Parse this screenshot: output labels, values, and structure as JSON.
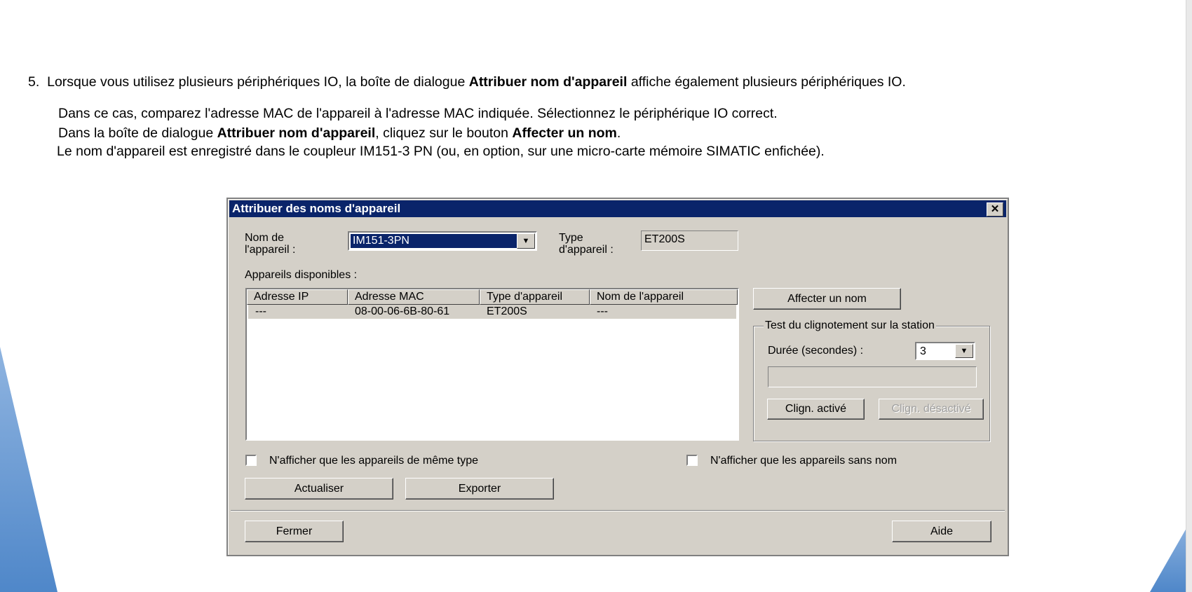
{
  "instructions": {
    "line1": {
      "num": "5.",
      "a": "Lorsque vous utilisez plusieurs périphériques IO, la boîte de dialogue ",
      "b": "Attribuer nom  d'appareil",
      "c": " affiche également plusieurs périphériques IO."
    },
    "line2": "Dans ce cas, comparez  l'adresse MAC de l'appareil à l'adresse MAC indiquée. Sélectionnez le périphérique IO  correct.",
    "line3": {
      "a": "Dans la boîte de dialogue ",
      "b": "Attribuer nom d'appareil",
      "c": ", cliquez sur le bouton ",
      "d": "Affecter  un nom",
      "e": "."
    },
    "line4": "Le nom d'appareil est enregistré dans le coupleur IM151-3 PN (ou, en option,  sur une micro-carte mémoire SIMATIC enfichée)."
  },
  "dialog": {
    "title": "Attribuer des noms d'appareil",
    "close_glyph": "✕",
    "device_name_label_1": "Nom de",
    "device_name_label_2": "l'appareil :",
    "device_name_value": "IM151-3PN",
    "device_type_label_1": "Type",
    "device_type_label_2": "d'appareil :",
    "device_type_value": "ET200S",
    "available_label": "Appareils disponibles :",
    "table": {
      "headers": [
        "Adresse IP",
        "Adresse MAC",
        "Type d'appareil",
        "Nom de l'appareil"
      ],
      "rows": [
        [
          "---",
          "08-00-06-6B-80-61",
          "ET200S",
          "---"
        ]
      ]
    },
    "assign_button": "Affecter un nom",
    "blink_group": {
      "title": "Test du clignotement sur la station",
      "duration_label": "Durée (secondes) :",
      "duration_value": "3",
      "blink_on": "Clign. activé",
      "blink_off": "Clign. désactivé"
    },
    "checkbox_same_type": "N'afficher que les appareils de même type",
    "checkbox_no_name": "N'afficher que les appareils sans nom",
    "refresh_button": "Actualiser",
    "export_button": "Exporter",
    "close_button": "Fermer",
    "help_button": "Aide"
  }
}
